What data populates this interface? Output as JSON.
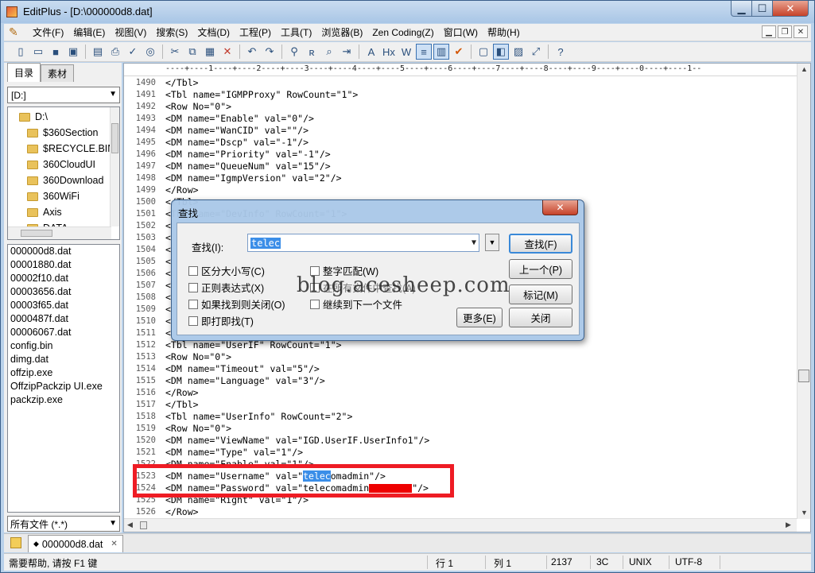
{
  "window": {
    "title": "EditPlus - [D:\\000000d8.dat]"
  },
  "menu": [
    "文件(F)",
    "编辑(E)",
    "视图(V)",
    "搜索(S)",
    "文档(D)",
    "工程(P)",
    "工具(T)",
    "浏览器(B)",
    "Zen Coding(Z)",
    "窗口(W)",
    "帮助(H)"
  ],
  "left_panel": {
    "tabs": [
      "目录",
      "素材"
    ],
    "drive": "[D:]",
    "tree": [
      "D:\\",
      "$360Section",
      "$RECYCLE.BIN",
      "360CloudUI",
      "360Download",
      "360WiFi",
      "Axis",
      "DATA"
    ],
    "files": [
      "000000d8.dat",
      "00001880.dat",
      "00002f10.dat",
      "00003656.dat",
      "00003f65.dat",
      "0000487f.dat",
      "00006067.dat",
      "config.bin",
      "dimg.dat",
      "offzip.exe",
      "OffzipPackzip UI.exe",
      "packzip.exe"
    ],
    "filter": "所有文件 (*.*)"
  },
  "editor": {
    "ruler": "----+----1----+----2----+----3----+----4----+----5----+----6----+----7----+----8----+----9----+----0----+----1--",
    "lines": [
      {
        "n": "1490",
        "t": "</Tbl>"
      },
      {
        "n": "1491",
        "t": "<Tbl name=\"IGMPProxy\" RowCount=\"1\">"
      },
      {
        "n": "1492",
        "t": "<Row No=\"0\">"
      },
      {
        "n": "1493",
        "t": "<DM name=\"Enable\" val=\"0\"/>"
      },
      {
        "n": "1494",
        "t": "<DM name=\"WanCID\" val=\"\"/>"
      },
      {
        "n": "1495",
        "t": "<DM name=\"Dscp\" val=\"-1\"/>"
      },
      {
        "n": "1496",
        "t": "<DM name=\"Priority\" val=\"-1\"/>"
      },
      {
        "n": "1497",
        "t": "<DM name=\"QueueNum\" val=\"15\"/>"
      },
      {
        "n": "1498",
        "t": "<DM name=\"IgmpVersion\" val=\"2\"/>"
      },
      {
        "n": "1499",
        "t": "</Row>"
      },
      {
        "n": "1500",
        "t": "</Tbl>"
      },
      {
        "n": "1501",
        "t": "<Tbl name=\"DevInfo\" RowCount=\"1\">"
      },
      {
        "n": "1502",
        "t": "<"
      },
      {
        "n": "1503",
        "t": "<"
      },
      {
        "n": "1504",
        "t": "<"
      },
      {
        "n": "1505",
        "t": "<"
      },
      {
        "n": "1506",
        "t": "<"
      },
      {
        "n": "1507",
        "t": "<"
      },
      {
        "n": "1508",
        "t": "<"
      },
      {
        "n": "1509",
        "t": "<"
      },
      {
        "n": "1510",
        "t": "<"
      },
      {
        "n": "1511",
        "t": "<"
      },
      {
        "n": "1512",
        "t": "<Tbl name=\"UserIF\" RowCount=\"1\">"
      },
      {
        "n": "1513",
        "t": "<Row No=\"0\">"
      },
      {
        "n": "1514",
        "t": "<DM name=\"Timeout\" val=\"5\"/>"
      },
      {
        "n": "1515",
        "t": "<DM name=\"Language\" val=\"3\"/>"
      },
      {
        "n": "1516",
        "t": "</Row>"
      },
      {
        "n": "1517",
        "t": "</Tbl>"
      },
      {
        "n": "1518",
        "t": "<Tbl name=\"UserInfo\" RowCount=\"2\">"
      },
      {
        "n": "1519",
        "t": "<Row No=\"0\">"
      },
      {
        "n": "1520",
        "t": "<DM name=\"ViewName\" val=\"IGD.UserIF.UserInfo1\"/>"
      },
      {
        "n": "1521",
        "t": "<DM name=\"Type\" val=\"1\"/>"
      },
      {
        "n": "1522",
        "t": "<DM name=\"Enable\" val=\"1\"/>"
      },
      {
        "n": "1523",
        "t": "<DM name=\"Username\" val=\"",
        "hl": "telec",
        "rest": "omadmin\"/>"
      },
      {
        "n": "1524",
        "t": "<DM name=\"Password\" val=\"telecomadmin",
        "redact": true,
        "rest": "\"/>"
      },
      {
        "n": "1525",
        "t": "<DM name=\"Right\" val=\"1\"/>"
      },
      {
        "n": "1526",
        "t": "</Row>"
      }
    ]
  },
  "find_dialog": {
    "title": "查找",
    "label": "查找(I):",
    "value": "telec",
    "options_left": [
      "区分大小写(C)",
      "正则表达式(X)",
      "如果找到则关闭(O)",
      "即打即找(T)"
    ],
    "options_right": [
      "整字匹配(W)",
      "在所有文件中查找(A)",
      "继续到下一个文件"
    ],
    "buttons": {
      "find": "查找(F)",
      "prev": "上一个(P)",
      "mark": "标记(M)",
      "more": "更多(E)",
      "close": "关闭"
    }
  },
  "watermark": "blog.acesheep.com",
  "doc_tab": "000000d8.dat",
  "status": {
    "help": "需要帮助, 请按 F1 键",
    "row": "行 1",
    "col": "列 1",
    "count": "2137",
    "hex": "3C",
    "eol": "UNIX",
    "enc": "UTF-8"
  }
}
